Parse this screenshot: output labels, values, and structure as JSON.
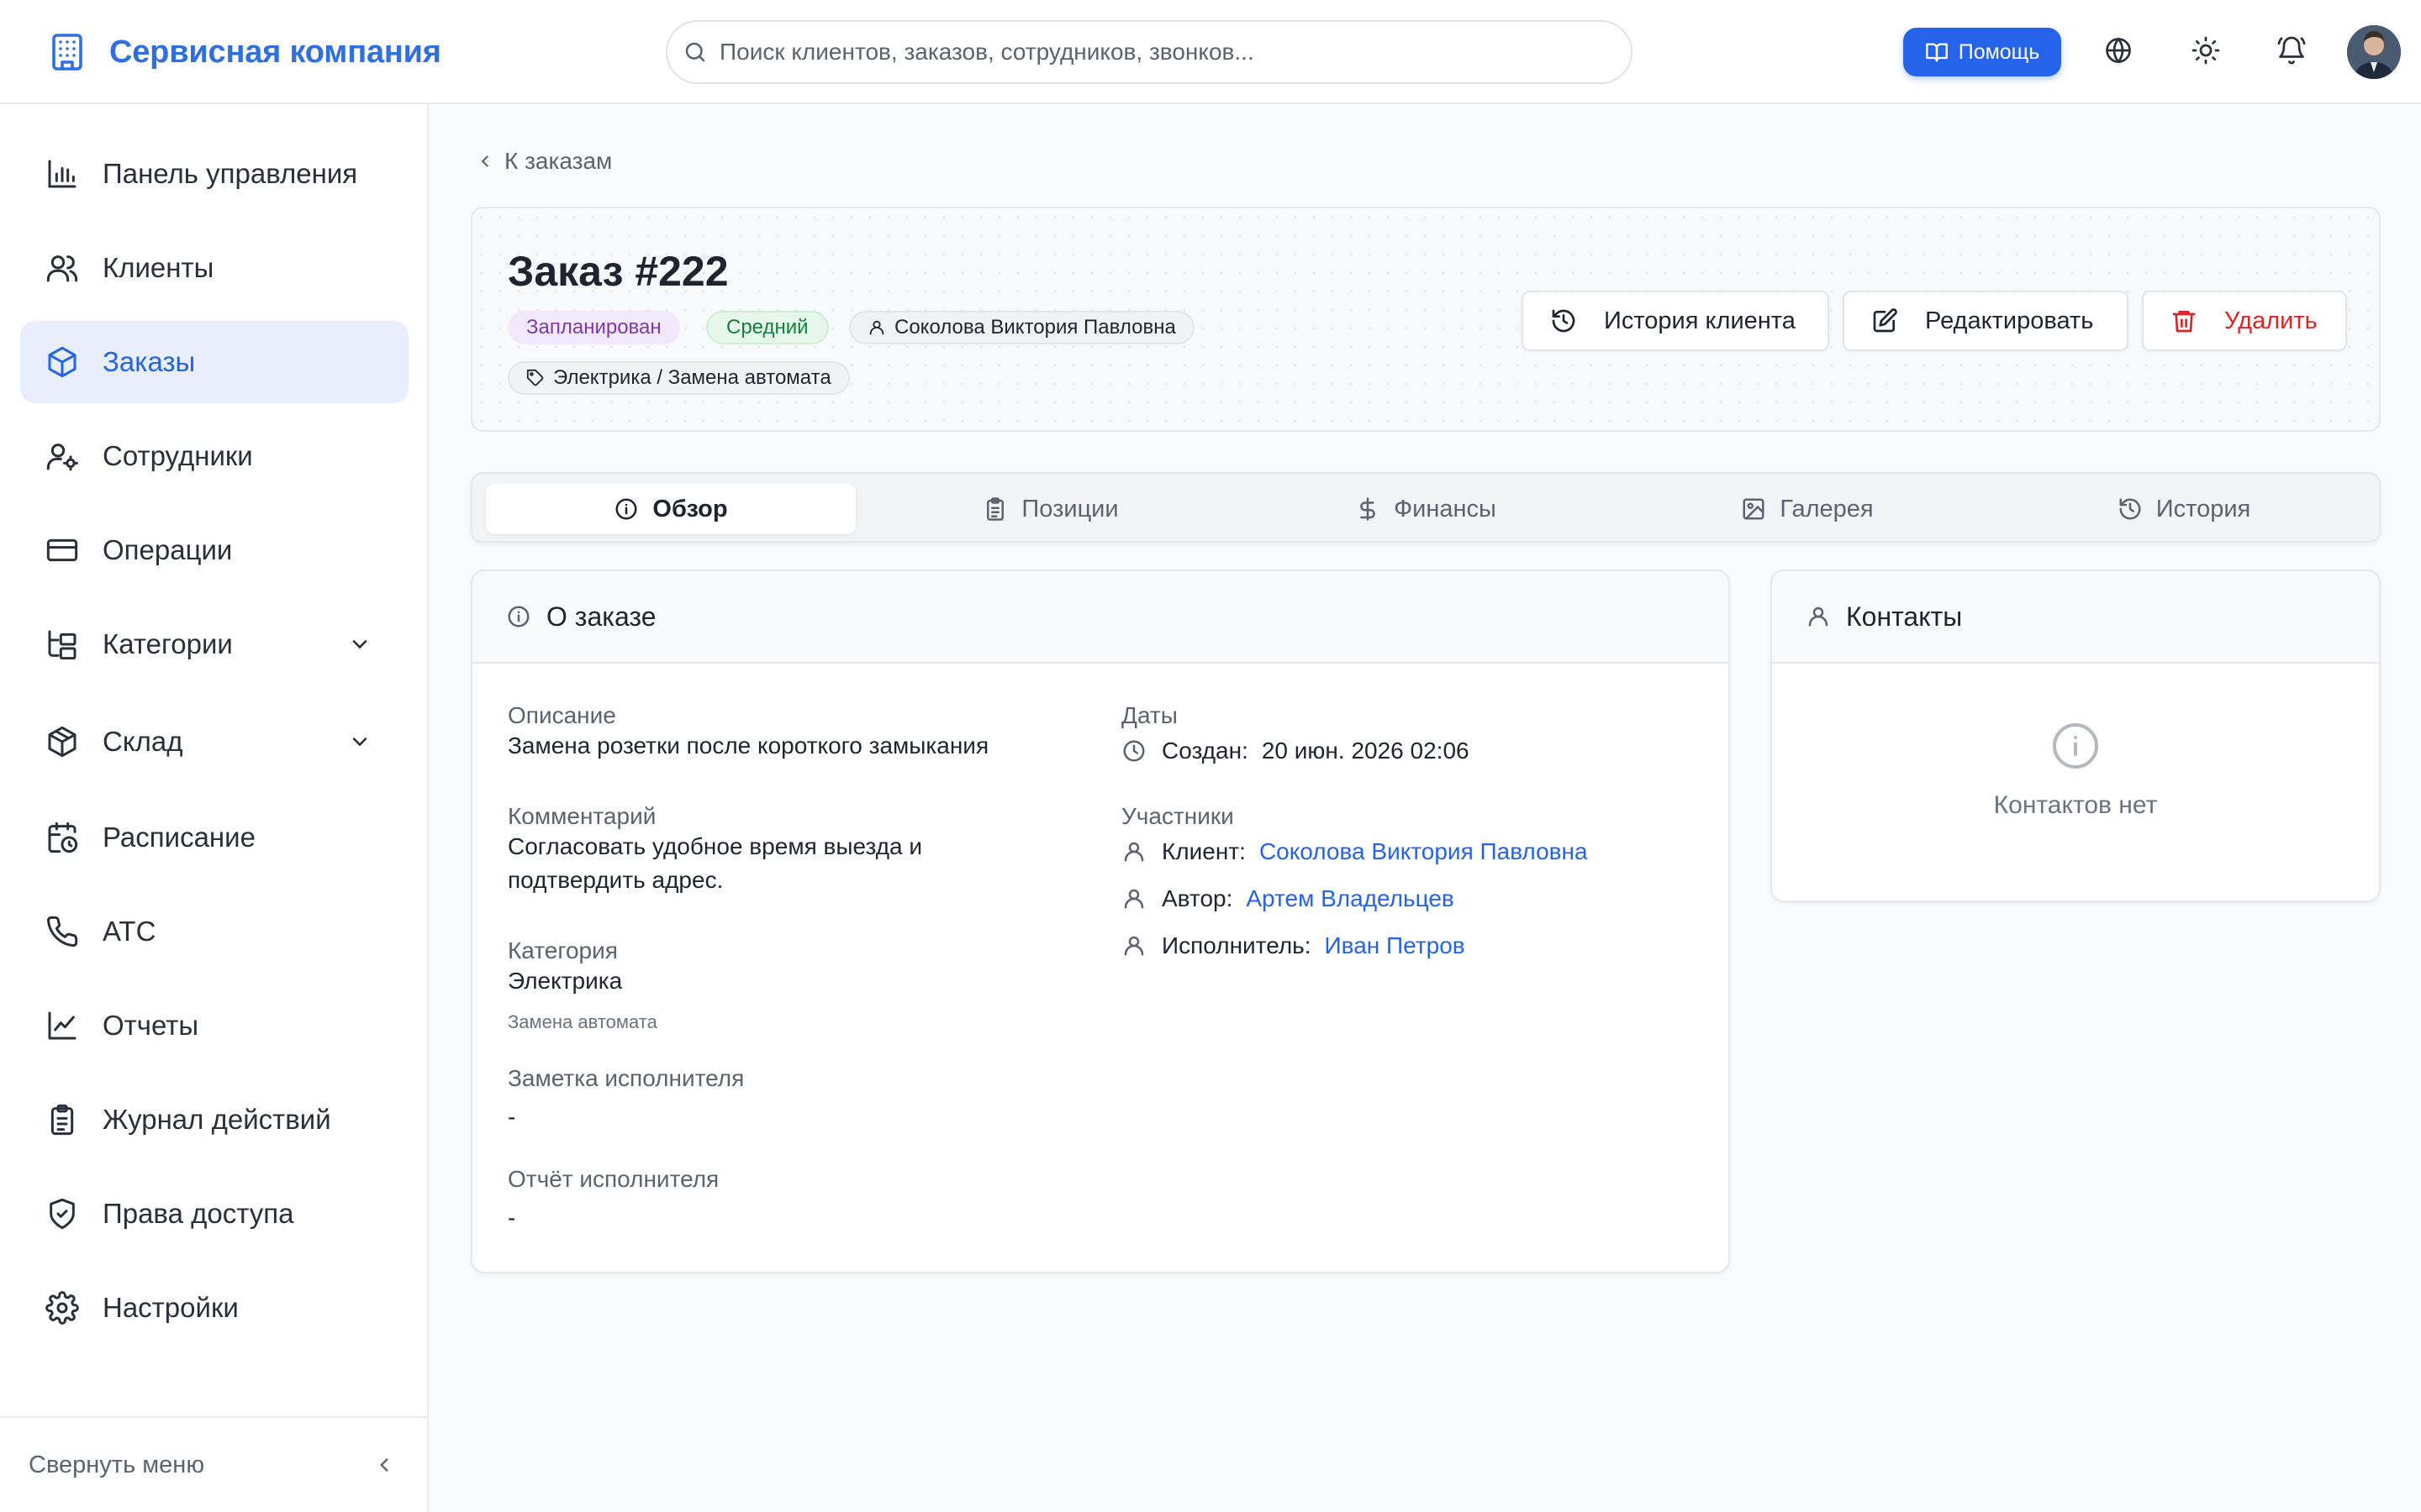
{
  "header": {
    "brand": "Сервисная компания",
    "search_placeholder": "Поиск клиентов, заказов, сотрудников, звонков...",
    "help_label": "Помощь"
  },
  "sidebar": {
    "items": [
      {
        "label": "Панель управления",
        "icon": "bar-chart-icon"
      },
      {
        "label": "Клиенты",
        "icon": "users-icon"
      },
      {
        "label": "Заказы",
        "icon": "package-icon",
        "active": true
      },
      {
        "label": "Сотрудники",
        "icon": "user-cog-icon"
      },
      {
        "label": "Операции",
        "icon": "credit-card-icon"
      },
      {
        "label": "Категории",
        "icon": "folder-tree-icon",
        "expandable": true
      },
      {
        "label": "Склад",
        "icon": "box-icon",
        "expandable": true
      },
      {
        "label": "Расписание",
        "icon": "calendar-clock-icon"
      },
      {
        "label": "АТС",
        "icon": "phone-icon"
      },
      {
        "label": "Отчеты",
        "icon": "line-chart-icon"
      },
      {
        "label": "Журнал действий",
        "icon": "clipboard-icon"
      },
      {
        "label": "Права доступа",
        "icon": "shield-check-icon"
      },
      {
        "label": "Настройки",
        "icon": "gear-icon"
      }
    ],
    "collapse_label": "Свернуть меню"
  },
  "main": {
    "back_label": "К заказам",
    "order": {
      "title": "Заказ #222",
      "status": "Запланирован",
      "priority": "Средний",
      "client": "Соколова Виктория Павловна",
      "category": "Электрика / Замена автомата"
    },
    "actions": {
      "history": "История клиента",
      "edit": "Редактировать",
      "delete": "Удалить"
    },
    "tabs": [
      "Обзор",
      "Позиции",
      "Финансы",
      "Галерея",
      "История"
    ],
    "about": {
      "title": "О заказе",
      "description_label": "Описание",
      "description": "Замена розетки после короткого замыкания",
      "comment_label": "Комментарий",
      "comment_line1": "Согласовать удобное время выезда и",
      "comment_line2": "подтвердить адрес.",
      "category_label": "Категория",
      "category": "Электрика",
      "subcategory": "Замена автомата",
      "executor_note_label": "Заметка исполнителя",
      "executor_note": "-",
      "executor_report_label": "Отчёт исполнителя",
      "executor_report": "-",
      "dates_label": "Даты",
      "created_key": "Создан:",
      "created_value": "20 июн. 2026 02:06",
      "participants_label": "Участники",
      "client_key": "Клиент:",
      "client_value": "Соколова Виктория Павловна",
      "author_key": "Автор:",
      "author_value": "Артем Владельцев",
      "executor_key": "Исполнитель:",
      "executor_value": "Иван Петров"
    },
    "contacts": {
      "title": "Контакты",
      "empty": "Контактов нет"
    }
  },
  "colors": {
    "accent": "#2563eb",
    "status_bg": "#f1e8fb",
    "status_text": "#7c3aad",
    "priority_bg": "#e6f6ea",
    "priority_text": "#15803d",
    "danger": "#dc2626"
  }
}
